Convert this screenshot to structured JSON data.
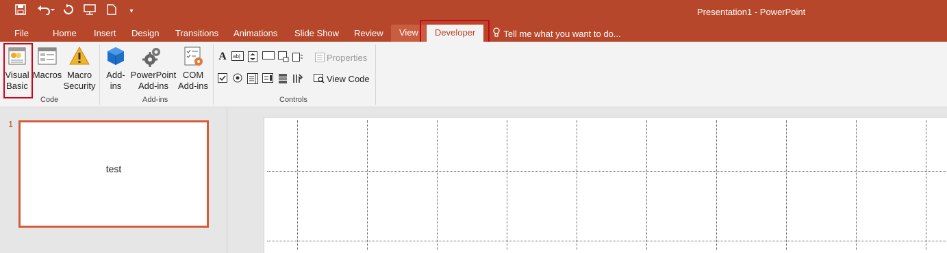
{
  "app": {
    "title": "Presentation1 - PowerPoint"
  },
  "qat": {
    "icons": [
      "save-icon",
      "undo-icon",
      "redo-icon",
      "present-icon",
      "new-icon",
      "customize-icon"
    ]
  },
  "tabs": {
    "file": "File",
    "home": "Home",
    "insert": "Insert",
    "design": "Design",
    "transitions": "Transitions",
    "animations": "Animations",
    "slideshow": "Slide Show",
    "review": "Review",
    "view": "View",
    "developer": "Developer",
    "tellme": "Tell me what you want to do..."
  },
  "ribbon": {
    "code": {
      "label": "Code",
      "visual_basic": [
        "Visual",
        "Basic"
      ],
      "macros": "Macros",
      "macro_security": [
        "Macro",
        "Security"
      ]
    },
    "addins": {
      "label": "Add-ins",
      "addins": [
        "Add-",
        "ins"
      ],
      "ppt_addins": [
        "PowerPoint",
        "Add-ins"
      ],
      "com_addins": [
        "COM",
        "Add-ins"
      ]
    },
    "controls": {
      "label": "Controls",
      "properties": "Properties",
      "view_code": "View Code"
    }
  },
  "slides": [
    {
      "number": "1",
      "text": "test"
    }
  ],
  "colors": {
    "accent": "#b7472a",
    "highlight": "#d0021b"
  }
}
